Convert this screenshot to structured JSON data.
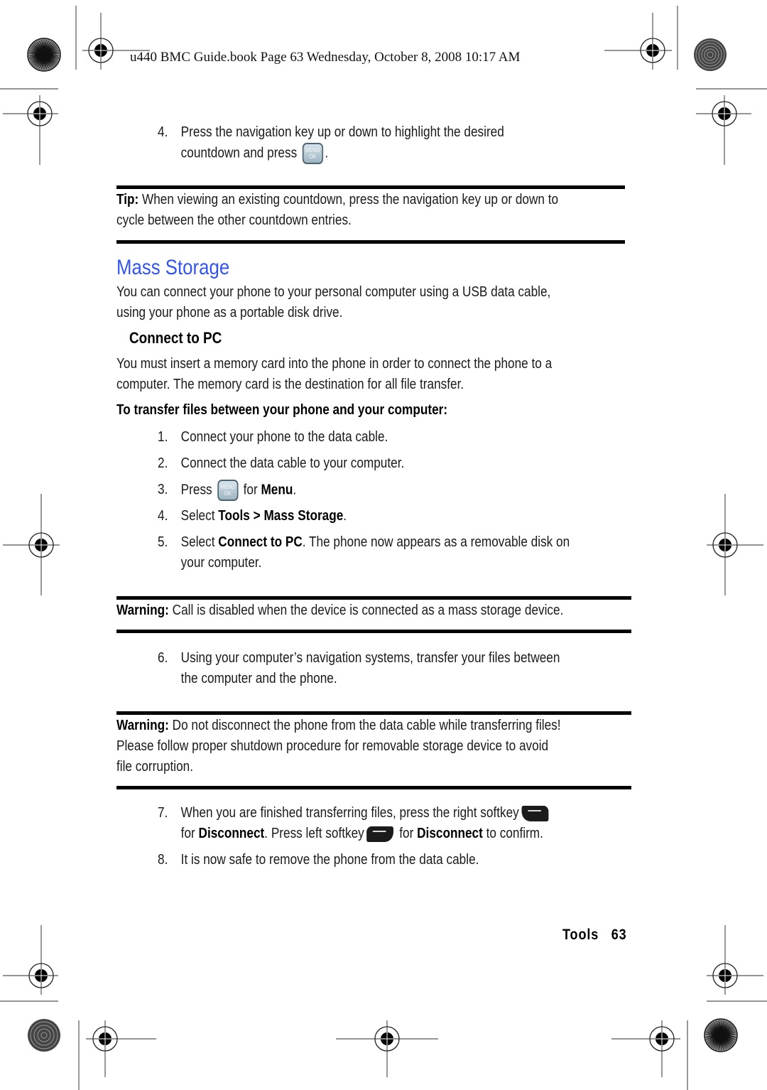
{
  "header": {
    "print_slug": "u440 BMC Guide.book  Page 63  Wednesday, October 8, 2008  10:17 AM"
  },
  "step_4_prev": {
    "number": "4.",
    "line1": "Press the navigation key up or down to highlight the desired",
    "line2_before": "countdown and press",
    "line2_after": ".",
    "key_icon": "menu-ok-key",
    "key_label_top": "MENU",
    "key_label_bottom": "OK"
  },
  "tip": {
    "label": "Tip:",
    "line1": " When viewing an existing countdown, press the navigation key up or down to",
    "line2": "cycle between the other countdown entries."
  },
  "section": {
    "title": "Mass Storage",
    "title_color": "#3355ee",
    "intro_line1": "You can connect your phone to your personal computer using a USB data cable,",
    "intro_line2": "using your phone as a portable disk drive."
  },
  "subsection": {
    "title": "Connect to PC",
    "para_line1": "You must insert a memory card into the phone in order to connect the phone to a",
    "para_line2": "computer. The memory card is the destination for all file transfer.",
    "procedure_heading": "To transfer files between your phone and your computer:"
  },
  "steps": [
    {
      "number": "1.",
      "text": "Connect your phone to the data cable."
    },
    {
      "number": "2.",
      "text": "Connect the data cable to your computer."
    },
    {
      "number": "3.",
      "before": "Press",
      "middle": " for ",
      "bold": "Menu",
      "after": ".",
      "key_label_top": "MENU",
      "key_label_bottom": "OK"
    },
    {
      "number": "4.",
      "before": "Select ",
      "bold": "Tools > Mass Storage",
      "after": "."
    },
    {
      "number": "5.",
      "before": "Select ",
      "bold": "Connect to PC",
      "after": ". The phone now appears as a removable disk on",
      "line2": "your computer."
    },
    {
      "number": "6.",
      "line1": "Using your computer’s navigation systems, transfer your files between",
      "line2": "the computer and the phone."
    },
    {
      "number": "7.",
      "line1": "When you are finished transferring files, press the right softkey",
      "l2_a": "for ",
      "l2_b": "Disconnect",
      "l2_c": ". Press left softkey",
      "l2_d": " for ",
      "l2_e": "Disconnect",
      "l2_f": " to confirm."
    },
    {
      "number": "8.",
      "text": "It is now safe to remove the phone from the data cable."
    }
  ],
  "warning1": {
    "label": "Warning:",
    "text": " Call is disabled when the device is connected as a mass storage device."
  },
  "warning2": {
    "label": "Warning:",
    "line1": " Do not disconnect the phone from the data cable while transferring files!",
    "line2": "Please follow proper shutdown procedure for removable storage device to avoid",
    "line3": "file corruption."
  },
  "footer": {
    "section": "Tools",
    "page_number": "63"
  }
}
